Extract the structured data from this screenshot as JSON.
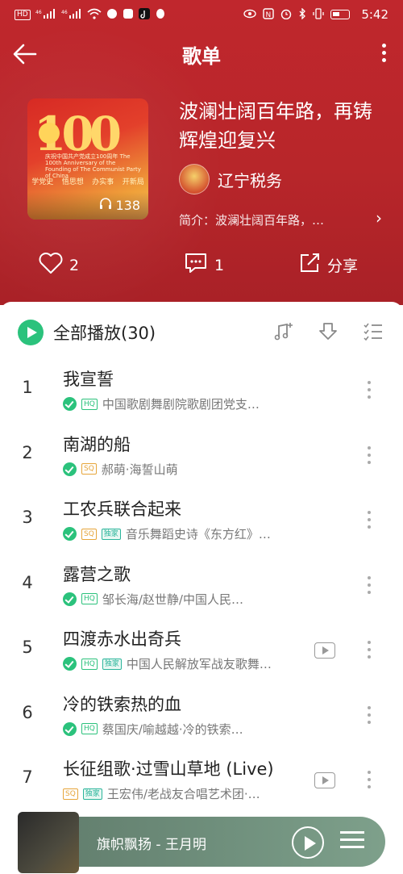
{
  "status_bar": {
    "left_badges": [
      "HD",
      "46",
      "46"
    ],
    "time": "5:42",
    "icons": [
      "signal-icon",
      "wifi-icon",
      "vpn-icon",
      "shield-icon",
      "tiktok-icon",
      "qq-icon",
      "eye-icon",
      "nfc-icon",
      "alarm-icon",
      "bluetooth-icon",
      "vibrate-icon",
      "battery-icon"
    ]
  },
  "header": {
    "title": "歌单"
  },
  "playlist": {
    "name": "波澜壮阔百年路，再铸辉煌迎复兴",
    "owner": "辽宁税务",
    "intro": "简介：波澜壮阔百年路，…",
    "play_count": "138",
    "cover": {
      "big_text": "100",
      "caption": "庆祝中国共产党成立100周年 The 100th Anniversary of the Founding of The Communist Party of China",
      "strip": [
        "学党史",
        "悟思想",
        "办实事",
        "开新局"
      ]
    }
  },
  "actions": {
    "like_count": "2",
    "comment_count": "1",
    "share_label": "分享"
  },
  "list_header": {
    "play_all_label": "全部播放(30)"
  },
  "songs": [
    {
      "index": "1",
      "title": "我宣誓",
      "quality": "HQ",
      "exclusive": "",
      "artist": "中国歌剧舞剧院歌剧团党支…",
      "mv": false
    },
    {
      "index": "2",
      "title": "南湖的船",
      "quality": "SQ",
      "exclusive": "",
      "artist": "郝萌·海誓山萌",
      "mv": false
    },
    {
      "index": "3",
      "title": "工农兵联合起来",
      "quality": "SQ",
      "exclusive": "独家",
      "artist": "音乐舞蹈史诗《东方红》…",
      "mv": false
    },
    {
      "index": "4",
      "title": "露营之歌",
      "quality": "HQ",
      "exclusive": "",
      "artist": "邹长海/赵世静/中国人民…",
      "mv": false
    },
    {
      "index": "5",
      "title": "四渡赤水出奇兵",
      "quality": "HQ",
      "exclusive": "独家",
      "artist": "中国人民解放军战友歌舞…",
      "mv": true
    },
    {
      "index": "6",
      "title": "冷的铁索热的血",
      "quality": "HQ",
      "exclusive": "",
      "artist": "蔡国庆/喻越越·冷的铁索…",
      "mv": false
    },
    {
      "index": "7",
      "title": "长征组歌·过雪山草地 (Live)",
      "quality": "SQ",
      "exclusive": "独家",
      "artist": "王宏伟/老战友合唱艺术团·…",
      "mv": true
    }
  ],
  "player": {
    "now_playing": "旗帜飘扬 - 王月明"
  },
  "colors": {
    "header_red": "#b8262a",
    "accent_green": "#2bc27c",
    "sq_gold": "#e6a53a"
  }
}
